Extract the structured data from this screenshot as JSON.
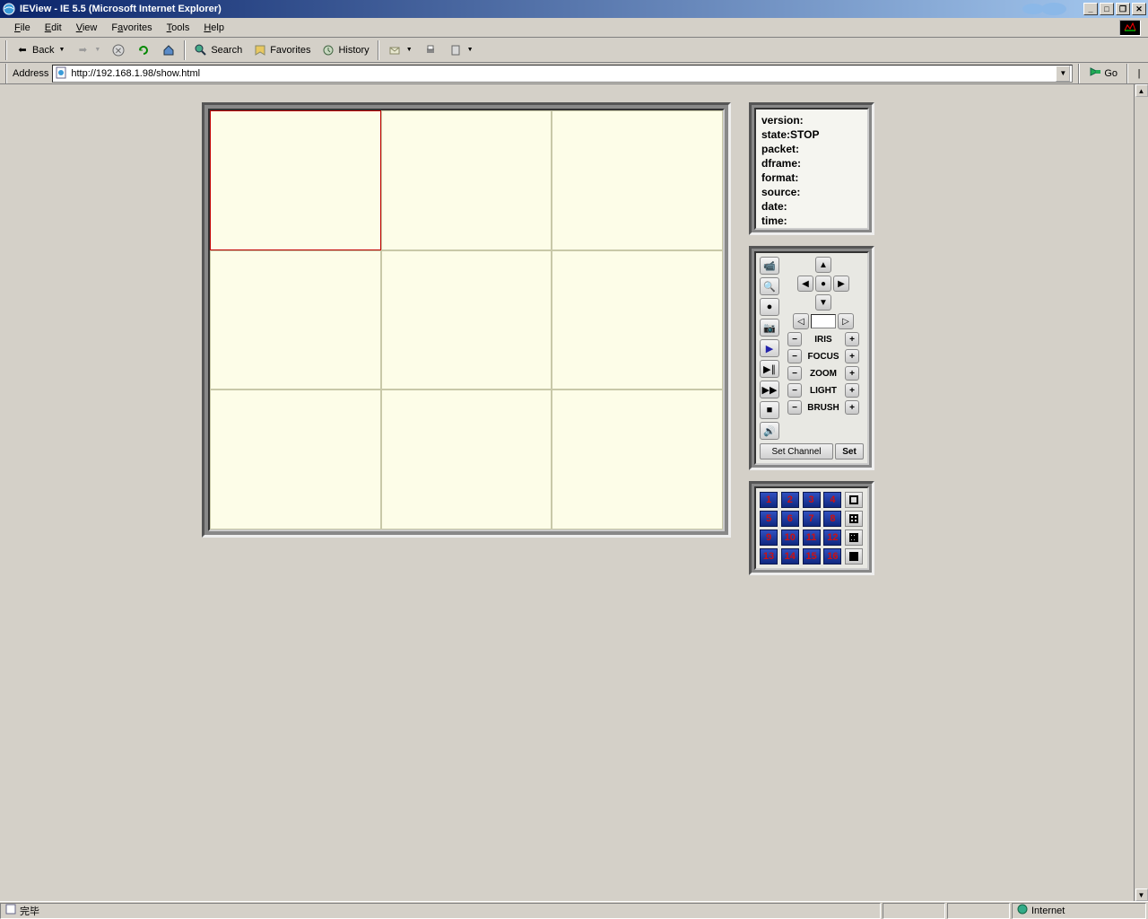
{
  "window": {
    "title": "IEView - IE 5.5 (Microsoft Internet Explorer)"
  },
  "menu": {
    "file": "File",
    "edit": "Edit",
    "view": "View",
    "favorites": "Favorites",
    "tools": "Tools",
    "help": "Help"
  },
  "toolbar": {
    "back": "Back",
    "search": "Search",
    "favorites": "Favorites",
    "history": "History"
  },
  "address": {
    "label": "Address",
    "value": "http://192.168.1.98/show.html",
    "go": "Go"
  },
  "info": {
    "version_label": "version:",
    "version": "",
    "state_label": "state:",
    "state": "STOP",
    "packet_label": "packet:",
    "packet": "",
    "dframe_label": "dframe:",
    "dframe": "",
    "format_label": "format:",
    "format": "",
    "source_label": "source:",
    "source": "",
    "date_label": "date:",
    "date": "",
    "time_label": "time:",
    "time": ""
  },
  "lens": {
    "iris": "IRIS",
    "focus": "FOCUS",
    "zoom": "ZOOM",
    "light": "LIGHT",
    "brush": "BRUSH"
  },
  "buttons": {
    "set_channel": "Set Channel",
    "set": "Set"
  },
  "channels": [
    "1",
    "2",
    "3",
    "4",
    "5",
    "6",
    "7",
    "8",
    "9",
    "10",
    "11",
    "12",
    "13",
    "14",
    "15",
    "16"
  ],
  "status": {
    "done": "完毕",
    "zone": "Internet"
  }
}
